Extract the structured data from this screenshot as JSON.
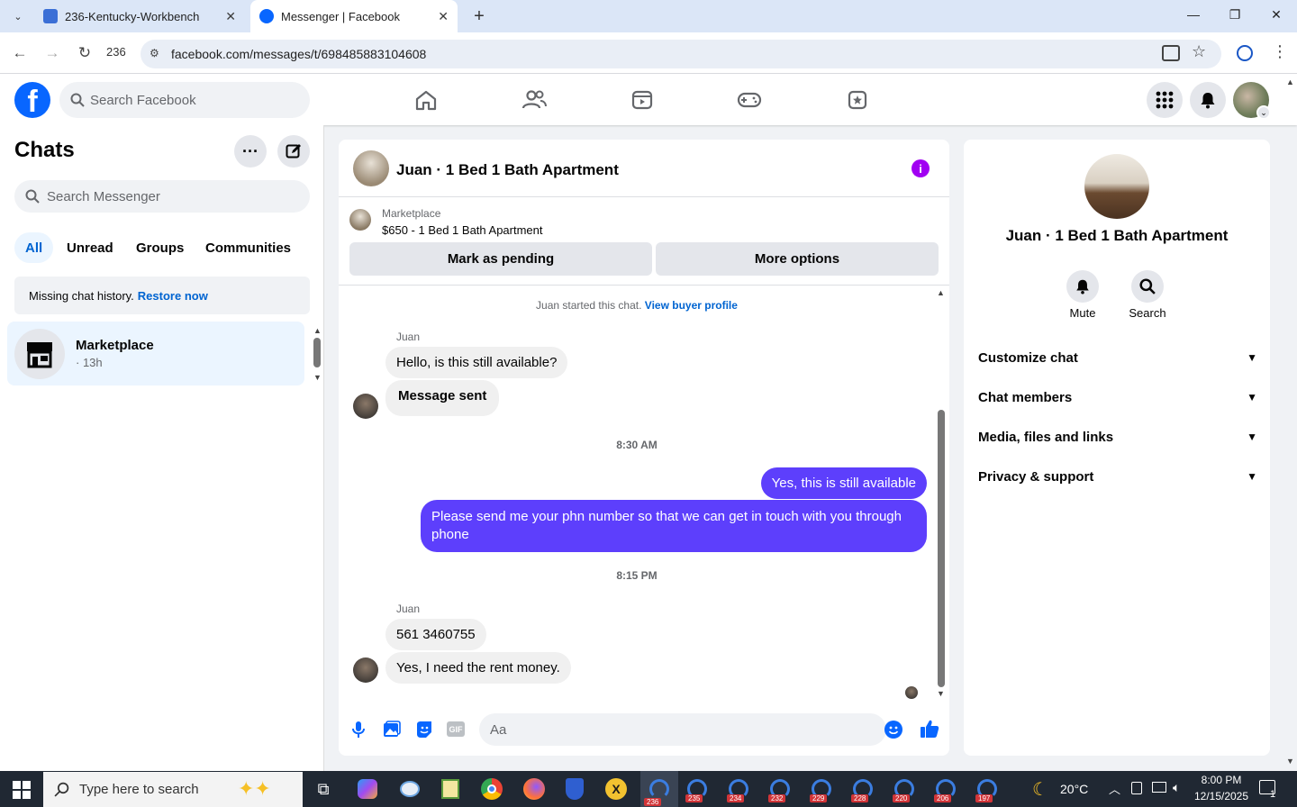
{
  "browser": {
    "tabs": [
      {
        "title": "236-Kentucky-Workbench"
      },
      {
        "title": "Messenger | Facebook"
      }
    ],
    "profile_label": "236",
    "url": "facebook.com/messages/t/698485883104608"
  },
  "fb_header": {
    "search_placeholder": "Search Facebook"
  },
  "sidebar": {
    "title": "Chats",
    "search_placeholder": "Search Messenger",
    "filters": [
      "All",
      "Unread",
      "Groups",
      "Communities"
    ],
    "missing_text": "Missing chat history.",
    "restore_link": "Restore now",
    "chat_items": [
      {
        "name": "Marketplace",
        "meta": "· 13h"
      }
    ]
  },
  "chat": {
    "title": "Juan · 1 Bed 1 Bath Apartment",
    "listing_source": "Marketplace",
    "listing_title": "$650 - 1 Bed 1 Bath Apartment",
    "mark_pending": "Mark as pending",
    "more_options": "More options",
    "started_text": "Juan started this chat.",
    "buyer_profile_link": "View buyer profile",
    "sender1": "Juan",
    "msg1": "Hello, is this still available?",
    "msg2": "Message sent",
    "time1": "8:30 AM",
    "out1": "Yes, this is still available",
    "out2": "Please send me your phn number so that we can get in touch with you through phone",
    "time2": "8:15 PM",
    "sender2": "Juan",
    "msg3": "561 3460755",
    "msg4": "Yes, I need the rent money.",
    "composer_placeholder": "Aa"
  },
  "details": {
    "name": "Juan · 1 Bed 1 Bath Apartment",
    "mute_label": "Mute",
    "search_label": "Search",
    "sections": [
      "Customize chat",
      "Chat members",
      "Media, files and links",
      "Privacy & support"
    ]
  },
  "taskbar": {
    "search_placeholder": "Type here to search",
    "edge_badges": [
      "236",
      "235",
      "234",
      "232",
      "229",
      "228",
      "220",
      "206",
      "197"
    ],
    "weather": "20°C",
    "time": "8:00 PM",
    "date": "12/15/2025",
    "notification_count": "1"
  },
  "colors": {
    "fb_blue": "#0866ff",
    "outgoing_bubble": "#5d3ffc",
    "link": "#0064d1"
  }
}
